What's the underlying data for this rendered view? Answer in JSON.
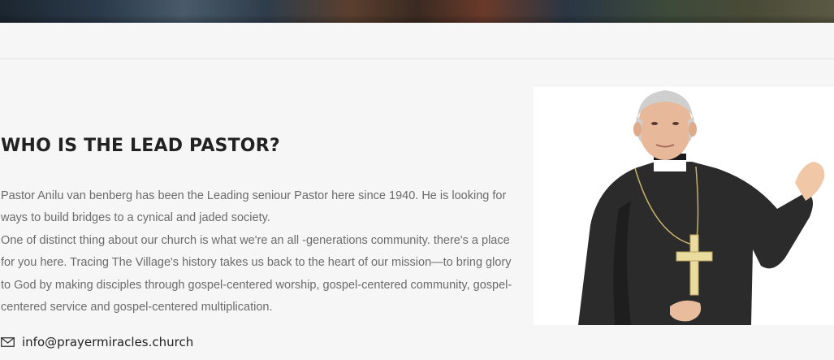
{
  "section": {
    "heading": "WHO IS THE LEAD PASTOR?",
    "paragraph_1": "Pastor Anilu van benberg has been the Leading seniour Pastor here since 1940. He is looking for ways to build bridges to a cynical and jaded society.",
    "paragraph_2": "One of distinct thing about our church is what we're an all -generations community. there's a place for you here. Tracing The Village's history takes us back to the heart of our mission—to bring glory to God by making disciples through gospel-centered worship, gospel-centered community, gospel-centered service and gospel-centered multiplication."
  },
  "contact": {
    "icon": "envelope-icon",
    "email": "info@prayermiracles.church"
  },
  "photo": {
    "subject": "pastor-photo"
  },
  "colors": {
    "background": "#f6f6f6",
    "heading": "#222222",
    "body_text": "#6b6b6b"
  }
}
